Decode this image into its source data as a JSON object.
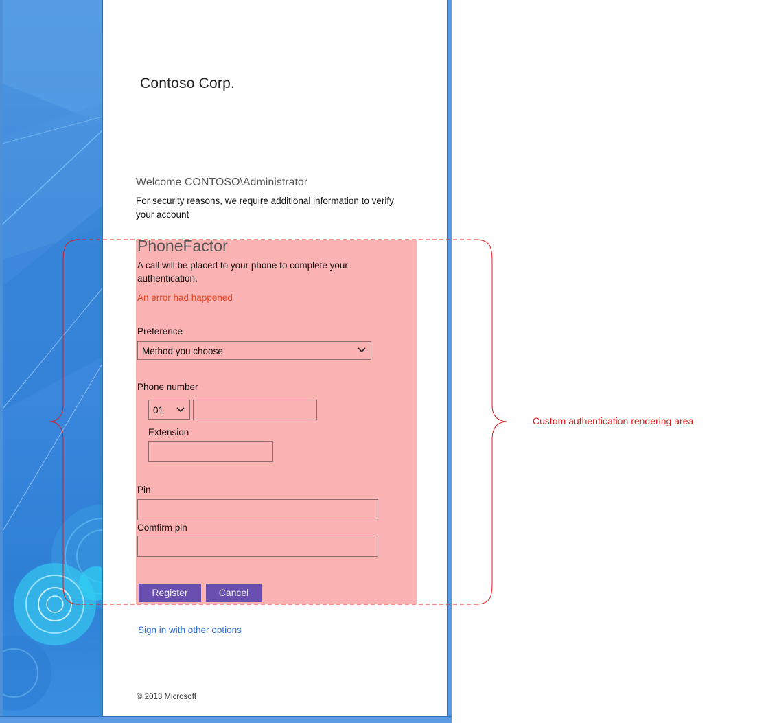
{
  "header": {
    "org_name": "Contoso Corp."
  },
  "intro": {
    "welcome": "Welcome CONTOSO\\Administrator",
    "security_message": "For security reasons, we require additional information to verify your account"
  },
  "phonefactor": {
    "title": "PhoneFactor",
    "description": "A call will be placed to your phone to complete your authentication.",
    "error": "An error had happened",
    "preference_label": "Preference",
    "preference_value": "Method you choose",
    "phone_label": "Phone number",
    "country_code": "01",
    "phone_value": "",
    "extension_label": "Extension",
    "extension_value": "",
    "pin_label": "Pin",
    "pin_value": "",
    "confirm_pin_label": "Comfirm pin",
    "confirm_pin_value": "",
    "register_label": "Register",
    "cancel_label": "Cancel"
  },
  "footer": {
    "other_options_link": "Sign in with other options",
    "copyright": "© 2013 Microsoft"
  },
  "annotation": {
    "label": "Custom authentication  rendering area",
    "color": "#e0191e"
  },
  "colors": {
    "auth_area_bg": "#fbb2b2",
    "button_bg": "#6b4fb0",
    "error_text": "#e8451a",
    "link_text": "#2e6fd6",
    "panel_blue": "#3a87dd"
  }
}
